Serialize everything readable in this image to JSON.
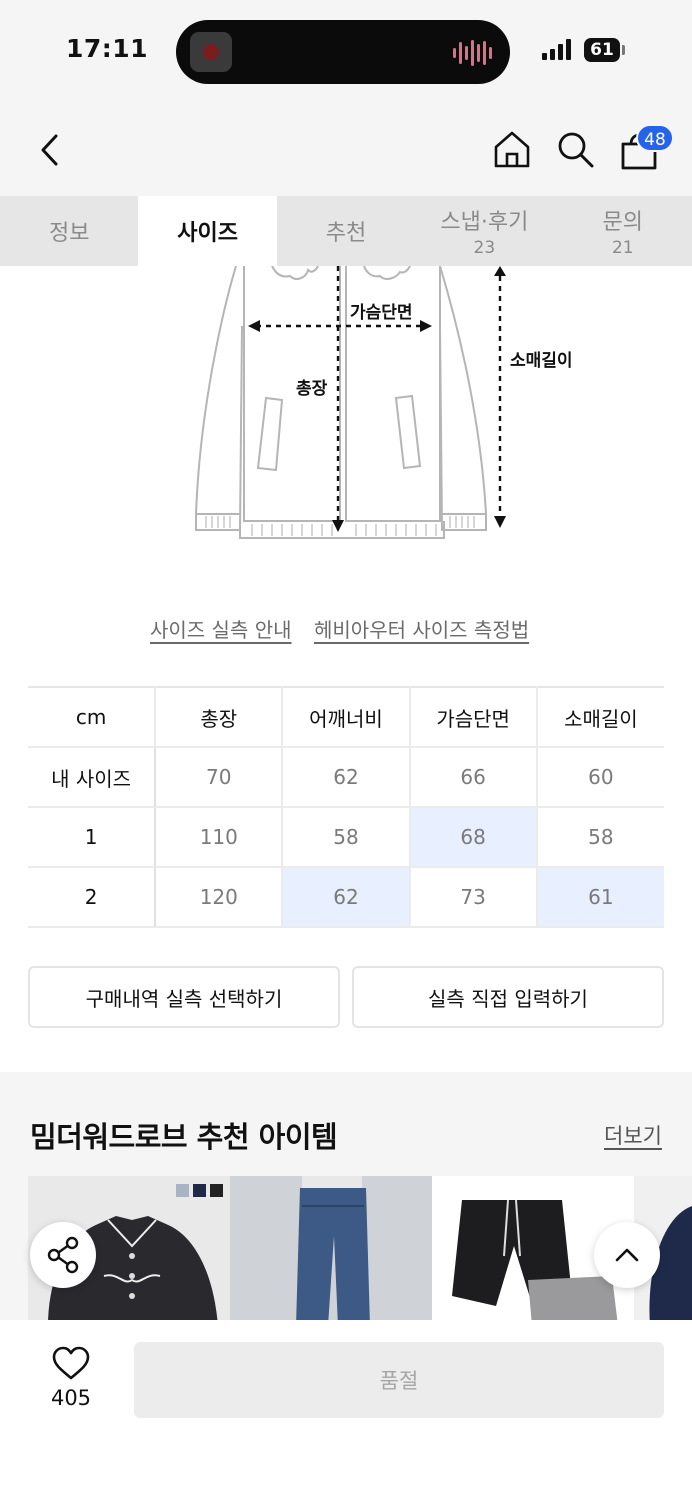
{
  "status_bar": {
    "time": "17:11",
    "battery": "61"
  },
  "header": {
    "cart_count": "48",
    "icons": [
      "back-arrow-icon",
      "home-icon",
      "search-icon",
      "shopping-bag-icon"
    ]
  },
  "tabs": [
    {
      "label": "정보",
      "sub": ""
    },
    {
      "label": "사이즈",
      "sub": "",
      "active": true
    },
    {
      "label": "추천",
      "sub": ""
    },
    {
      "label": "스냅·후기",
      "sub": "23"
    },
    {
      "label": "문의",
      "sub": "21"
    }
  ],
  "diagram": {
    "chest_label": "가슴단면",
    "length_label": "총장",
    "sleeve_label": "소매길이"
  },
  "guides": {
    "size_guide": "사이즈 실측 안내",
    "measure_guide": "헤비아우터 사이즈 측정법"
  },
  "size_table": {
    "headers": [
      "cm",
      "총장",
      "어깨너비",
      "가슴단면",
      "소매길이"
    ],
    "rows": [
      {
        "label": "내 사이즈",
        "values": [
          "70",
          "62",
          "66",
          "60"
        ]
      },
      {
        "label": "1",
        "values": [
          "110",
          "58",
          "68",
          "58"
        ]
      },
      {
        "label": "2",
        "values": [
          "120",
          "62",
          "73",
          "61"
        ]
      }
    ]
  },
  "actions": {
    "select_purchase": "구매내역 실측 선택하기",
    "direct_input": "실측 직접 입력하기"
  },
  "recommend": {
    "title": "밈더워드로브 추천 아이템",
    "more": "더보기"
  },
  "colors": {
    "accent": "#2563eb",
    "highlight": "#e8efff"
  },
  "bottom": {
    "like_count": "405",
    "soldout_label": "품절"
  }
}
